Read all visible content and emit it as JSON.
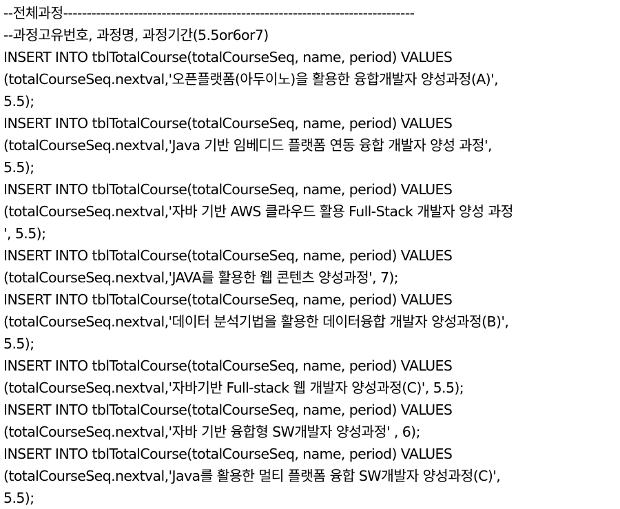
{
  "editor": {
    "lines": [
      "--전체과정---------------------------------------------------------------------------",
      "--과정고유번호, 과정명, 과정기간(5.5or6or7)",
      "INSERT INTO tblTotalCourse(totalCourseSeq, name, period) VALUES",
      "(totalCourseSeq.nextval,'오픈플랫폼(아두이노)을 활용한 융합개발자 양성과정(A)',",
      "5.5);",
      "INSERT INTO tblTotalCourse(totalCourseSeq, name, period) VALUES",
      "(totalCourseSeq.nextval,'Java 기반 임베디드 플랫폼 연동 융합 개발자 양성 과정',",
      "5.5);",
      "INSERT INTO tblTotalCourse(totalCourseSeq, name, period) VALUES",
      "(totalCourseSeq.nextval,'자바 기반 AWS 클라우드 활용 Full-Stack 개발자 양성 과정",
      "', 5.5);",
      "INSERT INTO tblTotalCourse(totalCourseSeq, name, period) VALUES",
      "(totalCourseSeq.nextval,'JAVA를 활용한 웹 콘텐츠 양성과정', 7);",
      "INSERT INTO tblTotalCourse(totalCourseSeq, name, period) VALUES",
      "(totalCourseSeq.nextval,'데이터 분석기법을 활용한 데이터융합 개발자 양성과정(B)',",
      "5.5);",
      "INSERT INTO tblTotalCourse(totalCourseSeq, name, period) VALUES",
      "(totalCourseSeq.nextval,'자바기반 Full-stack 웹 개발자 양성과정(C)', 5.5);",
      "INSERT INTO tblTotalCourse(totalCourseSeq, name, period) VALUES",
      "(totalCourseSeq.nextval,'자바 기반 융합형 SW개발자 양성과정' , 6);",
      "INSERT INTO tblTotalCourse(totalCourseSeq, name, period) VALUES",
      "(totalCourseSeq.nextval,'Java를 활용한 멀티 플랫폼 융합 SW개발자 양성과정(C)',",
      "5.5);"
    ]
  }
}
